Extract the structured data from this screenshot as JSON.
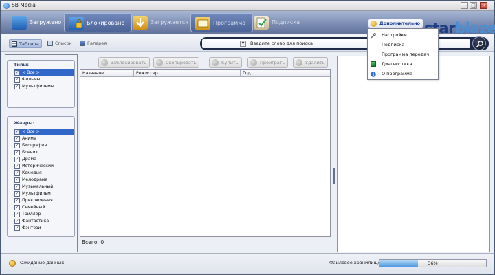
{
  "window": {
    "title": "SB Media"
  },
  "toolbar": {
    "items": [
      {
        "label": "Загружено"
      },
      {
        "label": "Блокировано"
      },
      {
        "label": "Загружается"
      },
      {
        "label": "Программа"
      },
      {
        "label": "Подписка"
      }
    ],
    "extra_label": "Дополнительно"
  },
  "brand": {
    "part1": "star",
    "part2": "blazer"
  },
  "views": [
    {
      "label": "Таблица"
    },
    {
      "label": "Список"
    },
    {
      "label": "Галерея"
    }
  ],
  "search": {
    "placeholder": "Введите слово для поиска"
  },
  "types": {
    "title": "Типы:",
    "items": [
      {
        "label": "< Все >",
        "selected": true
      },
      {
        "label": "Фильмы"
      },
      {
        "label": "Мультфильмы"
      }
    ]
  },
  "genres": {
    "title": "Жанры:",
    "items": [
      {
        "label": "< Все >",
        "selected": true
      },
      {
        "label": "Аниме"
      },
      {
        "label": "Биография"
      },
      {
        "label": "Боевик"
      },
      {
        "label": "Драма"
      },
      {
        "label": "Исторический"
      },
      {
        "label": "Комедия"
      },
      {
        "label": "Мелодрама"
      },
      {
        "label": "Музыкальный"
      },
      {
        "label": "Мультфильм"
      },
      {
        "label": "Приключения"
      },
      {
        "label": "Семейный"
      },
      {
        "label": "Триллер"
      },
      {
        "label": "Фантастика"
      },
      {
        "label": "Фэнтези"
      }
    ]
  },
  "actions": [
    {
      "label": "Заблокировать"
    },
    {
      "label": "Скопировать"
    },
    {
      "label": "Купить"
    },
    {
      "label": "Проиграть"
    },
    {
      "label": "Удалить"
    }
  ],
  "grid": {
    "columns": [
      "Название",
      "Режиссер",
      "Год"
    ]
  },
  "total": "Всего: 0",
  "menu": {
    "items": [
      {
        "label": "Настройки",
        "icon": "wrench-icon"
      },
      {
        "label": "Подписка",
        "icon": ""
      },
      {
        "label": "Программа передач",
        "icon": ""
      },
      {
        "label": "Диагностика",
        "icon": "diagnostics-icon"
      },
      {
        "label": "О программе",
        "icon": "info-icon"
      }
    ]
  },
  "status": {
    "text": "Ожидание данных",
    "storage_label": "Файловое хранилище:",
    "storage_percent": "36%",
    "storage_fraction": 0.36
  },
  "colors": {
    "toolbar": "#7c8db4",
    "selection": "#3167c8",
    "brand_dark": "#1f3e83",
    "brand_light": "#4d8ed0",
    "progress": "#4c9be0"
  }
}
